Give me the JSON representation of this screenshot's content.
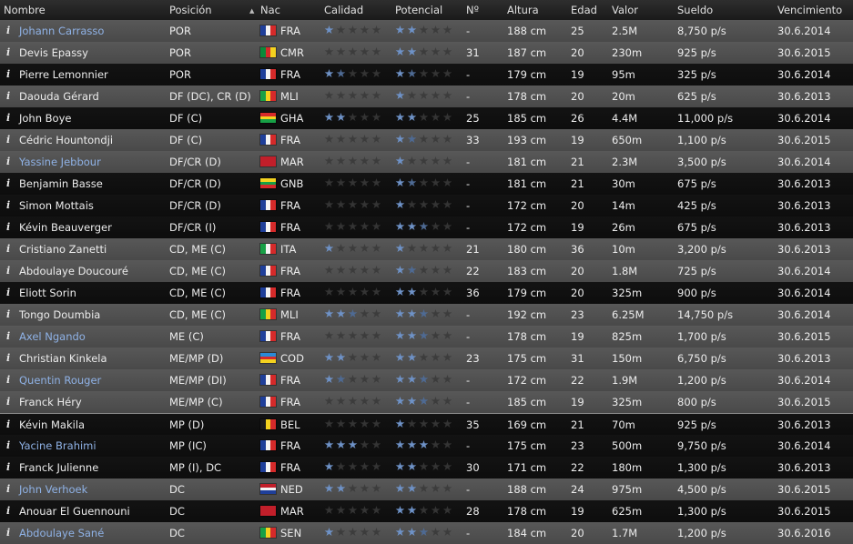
{
  "headers": {
    "name": "Nombre",
    "position": "Posición",
    "nation": "Nac",
    "quality": "Calidad",
    "potential": "Potencial",
    "number": "Nº",
    "height": "Altura",
    "age": "Edad",
    "value": "Valor",
    "salary": "Sueldo",
    "expiry": "Vencimiento"
  },
  "sort_icon": "sort-ascending-icon",
  "colors": {
    "star_filled": "#6e92c7",
    "star_empty": "#343434",
    "link_name": "#8fb2e6",
    "row_light": "#525252",
    "row_dark": "#101010"
  },
  "players": [
    {
      "info": "i",
      "name": "Johann Carrasso",
      "link": true,
      "position": "POR",
      "nation": "FRA",
      "quality": 1,
      "potential": 2,
      "number": "-",
      "height": "188 cm",
      "age": "25",
      "value": "2.5M",
      "salary": "8,750 p/s",
      "expiry": "30.6.2014",
      "shade": "light"
    },
    {
      "info": "i",
      "name": "Devis Epassy",
      "link": false,
      "position": "POR",
      "nation": "CMR",
      "quality": 0,
      "potential": 2,
      "number": "31",
      "height": "187 cm",
      "age": "20",
      "value": "230m",
      "salary": "925 p/s",
      "expiry": "30.6.2015",
      "shade": "light"
    },
    {
      "info": "i",
      "name": "Pierre Lemonnier",
      "link": false,
      "position": "POR",
      "nation": "FRA",
      "quality": 1.5,
      "potential": 1.5,
      "number": "-",
      "height": "179 cm",
      "age": "19",
      "value": "95m",
      "salary": "325 p/s",
      "expiry": "30.6.2014",
      "shade": "dark"
    },
    {
      "info": "i",
      "name": "Daouda Gérard",
      "link": false,
      "position": "DF (DC), CR (D)",
      "nation": "MLI",
      "quality": 0,
      "potential": 1,
      "number": "-",
      "height": "178 cm",
      "age": "20",
      "value": "20m",
      "salary": "625 p/s",
      "expiry": "30.6.2013",
      "shade": "light"
    },
    {
      "info": "i",
      "name": "John Boye",
      "link": false,
      "position": "DF (C)",
      "nation": "GHA",
      "quality": 2,
      "potential": 2,
      "number": "25",
      "height": "185 cm",
      "age": "26",
      "value": "4.4M",
      "salary": "11,000 p/s",
      "expiry": "30.6.2014",
      "shade": "dark"
    },
    {
      "info": "i",
      "name": "Cédric Hountondji",
      "link": false,
      "position": "DF (C)",
      "nation": "FRA",
      "quality": 0,
      "potential": 1.5,
      "number": "33",
      "height": "193 cm",
      "age": "19",
      "value": "650m",
      "salary": "1,100 p/s",
      "expiry": "30.6.2015",
      "shade": "light"
    },
    {
      "info": "i",
      "name": "Yassine Jebbour",
      "link": true,
      "position": "DF/CR (D)",
      "nation": "MAR",
      "quality": 0,
      "potential": 1,
      "number": "-",
      "height": "181 cm",
      "age": "21",
      "value": "2.3M",
      "salary": "3,500 p/s",
      "expiry": "30.6.2014",
      "shade": "light"
    },
    {
      "info": "i",
      "name": "Benjamin Basse",
      "link": false,
      "position": "DF/CR (D)",
      "nation": "GNB",
      "quality": 0,
      "potential": 1.5,
      "number": "-",
      "height": "181 cm",
      "age": "21",
      "value": "30m",
      "salary": "675 p/s",
      "expiry": "30.6.2013",
      "shade": "dark"
    },
    {
      "info": "i",
      "name": "Simon Mottais",
      "link": false,
      "position": "DF/CR (D)",
      "nation": "FRA",
      "quality": 0,
      "potential": 1,
      "number": "-",
      "height": "172 cm",
      "age": "20",
      "value": "14m",
      "salary": "425 p/s",
      "expiry": "30.6.2013",
      "shade": "dark"
    },
    {
      "info": "i",
      "name": "Kévin Beauverger",
      "link": false,
      "position": "DF/CR (I)",
      "nation": "FRA",
      "quality": 0,
      "potential": 2.5,
      "number": "-",
      "height": "172 cm",
      "age": "19",
      "value": "26m",
      "salary": "675 p/s",
      "expiry": "30.6.2013",
      "shade": "dark"
    },
    {
      "info": "i",
      "name": "Cristiano Zanetti",
      "link": false,
      "position": "CD, ME (C)",
      "nation": "ITA",
      "quality": 1,
      "potential": 1,
      "number": "21",
      "height": "180 cm",
      "age": "36",
      "value": "10m",
      "salary": "3,200 p/s",
      "expiry": "30.6.2013",
      "shade": "light"
    },
    {
      "info": "i",
      "name": "Abdoulaye Doucouré",
      "link": false,
      "position": "CD, ME (C)",
      "nation": "FRA",
      "quality": 0,
      "potential": 1.5,
      "number": "22",
      "height": "183 cm",
      "age": "20",
      "value": "1.8M",
      "salary": "725 p/s",
      "expiry": "30.6.2014",
      "shade": "light"
    },
    {
      "info": "i",
      "name": "Eliott Sorin",
      "link": false,
      "position": "CD, ME (C)",
      "nation": "FRA",
      "quality": 0,
      "potential": 2,
      "number": "36",
      "height": "179 cm",
      "age": "20",
      "value": "325m",
      "salary": "900 p/s",
      "expiry": "30.6.2014",
      "shade": "dark"
    },
    {
      "info": "i",
      "name": "Tongo Doumbia",
      "link": false,
      "position": "CD, ME (C)",
      "nation": "MLI",
      "quality": 2.5,
      "potential": 2.5,
      "number": "-",
      "height": "192 cm",
      "age": "23",
      "value": "6.25M",
      "salary": "14,750 p/s",
      "expiry": "30.6.2014",
      "shade": "light"
    },
    {
      "info": "i",
      "name": "Axel Ngando",
      "link": true,
      "position": "ME (C)",
      "nation": "FRA",
      "quality": 0,
      "potential": 2.5,
      "number": "-",
      "height": "178 cm",
      "age": "19",
      "value": "825m",
      "salary": "1,700 p/s",
      "expiry": "30.6.2015",
      "shade": "light"
    },
    {
      "info": "i",
      "name": "Christian Kinkela",
      "link": false,
      "position": "ME/MP (D)",
      "nation": "COD",
      "quality": 2,
      "potential": 2,
      "number": "23",
      "height": "175 cm",
      "age": "31",
      "value": "150m",
      "salary": "6,750 p/s",
      "expiry": "30.6.2013",
      "shade": "light"
    },
    {
      "info": "i",
      "name": "Quentin Rouger",
      "link": true,
      "position": "ME/MP (DI)",
      "nation": "FRA",
      "quality": 1.5,
      "potential": 2.5,
      "number": "-",
      "height": "172 cm",
      "age": "22",
      "value": "1.9M",
      "salary": "1,200 p/s",
      "expiry": "30.6.2014",
      "shade": "light"
    },
    {
      "info": "i",
      "name": "Franck Héry",
      "link": false,
      "position": "ME/MP (C)",
      "nation": "FRA",
      "quality": 0,
      "potential": 2.5,
      "number": "-",
      "height": "185 cm",
      "age": "19",
      "value": "325m",
      "salary": "800 p/s",
      "expiry": "30.6.2015",
      "shade": "light"
    },
    {
      "info": "i",
      "name": "Kévin Makila",
      "link": false,
      "position": "MP (D)",
      "nation": "BEL",
      "quality": 0,
      "potential": 1,
      "number": "35",
      "height": "169 cm",
      "age": "21",
      "value": "70m",
      "salary": "925 p/s",
      "expiry": "30.6.2013",
      "shade": "dark"
    },
    {
      "info": "i",
      "name": "Yacine Brahimi",
      "link": true,
      "position": "MP (IC)",
      "nation": "FRA",
      "quality": 3,
      "potential": 3,
      "number": "-",
      "height": "175 cm",
      "age": "23",
      "value": "500m",
      "salary": "9,750 p/s",
      "expiry": "30.6.2014",
      "shade": "dark"
    },
    {
      "info": "i",
      "name": "Franck Julienne",
      "link": false,
      "position": "MP (I), DC",
      "nation": "FRA",
      "quality": 1,
      "potential": 2,
      "number": "30",
      "height": "171 cm",
      "age": "22",
      "value": "180m",
      "salary": "1,300 p/s",
      "expiry": "30.6.2013",
      "shade": "dark"
    },
    {
      "info": "i",
      "name": "John Verhoek",
      "link": true,
      "position": "DC",
      "nation": "NED",
      "quality": 2,
      "potential": 2,
      "number": "-",
      "height": "188 cm",
      "age": "24",
      "value": "975m",
      "salary": "4,500 p/s",
      "expiry": "30.6.2015",
      "shade": "light"
    },
    {
      "info": "i",
      "name": "Anouar El Guennouni",
      "link": false,
      "position": "DC",
      "nation": "MAR",
      "quality": 0,
      "potential": 2,
      "number": "28",
      "height": "178 cm",
      "age": "19",
      "value": "625m",
      "salary": "1,300 p/s",
      "expiry": "30.6.2015",
      "shade": "dark"
    },
    {
      "info": "i",
      "name": "Abdoulaye Sané",
      "link": true,
      "position": "DC",
      "nation": "SEN",
      "quality": 1,
      "potential": 2.5,
      "number": "-",
      "height": "184 cm",
      "age": "20",
      "value": "1.7M",
      "salary": "1,200 p/s",
      "expiry": "30.6.2016",
      "shade": "light"
    }
  ]
}
